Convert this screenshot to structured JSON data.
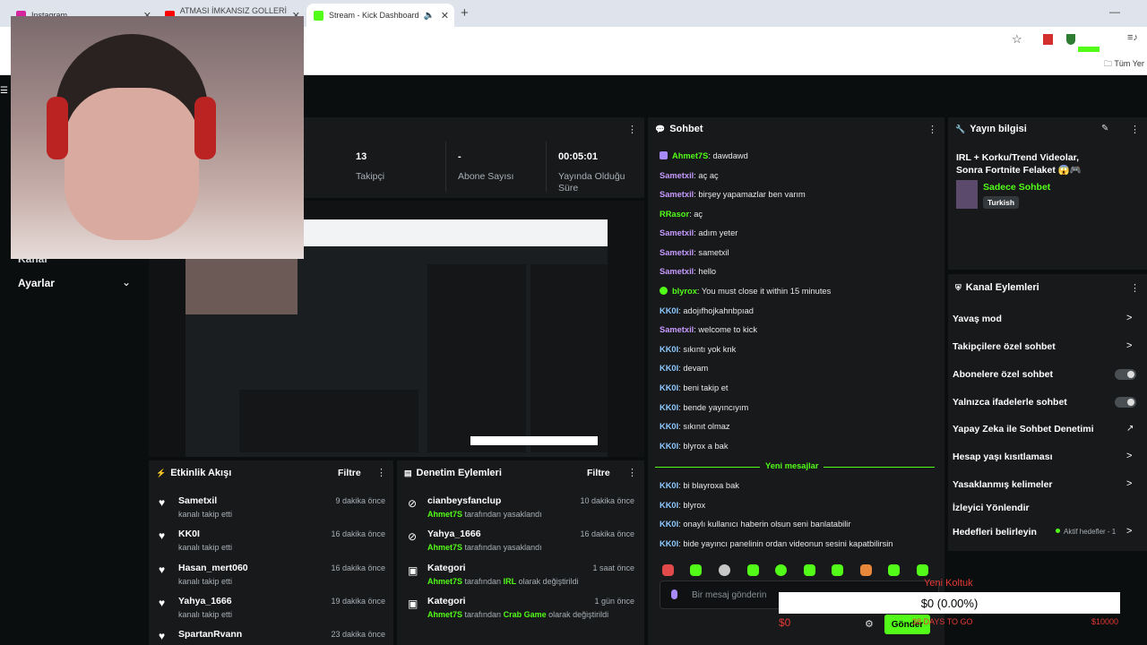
{
  "browser": {
    "tabs": [
      {
        "label": "Instagram"
      },
      {
        "label": "ATMASI İMKANSIZ GOLLERİ D..."
      },
      {
        "label": "Stream - Kick Dashboard"
      }
    ],
    "bookmarks_right": "Tüm Yer"
  },
  "sidebar": {
    "items": [
      {
        "label": "Kanal"
      },
      {
        "label": "Ayarlar"
      }
    ]
  },
  "stats": [
    {
      "value": "13",
      "label": "Takipçi"
    },
    {
      "value": "-",
      "label": "Abone Sayısı"
    },
    {
      "value": "00:05:01",
      "label": "Yayında Olduğu Süre"
    }
  ],
  "chat": {
    "title": "Sohbet",
    "messages": [
      {
        "user": "Ahmet7S",
        "text": ": dawdawd",
        "color": "#53fc18"
      },
      {
        "user": "Sametxil",
        "text": ": aç aç",
        "color": "#c79bff"
      },
      {
        "user": "Sametxil",
        "text": ": birşey yapamazlar ben varım",
        "color": "#c79bff"
      },
      {
        "user": "RRasor",
        "text": ": aç",
        "color": "#53fc18"
      },
      {
        "user": "Sametxil",
        "text": ": adım yeter",
        "color": "#c79bff"
      },
      {
        "user": "Sametxil",
        "text": ": sametxil",
        "color": "#c79bff"
      },
      {
        "user": "Sametxil",
        "text": ": hello",
        "color": "#c79bff"
      },
      {
        "user": "blyrox",
        "text": ": You must close it within 15 minutes",
        "color": "#53fc18"
      },
      {
        "user": "KK0I",
        "text": ": adojıfhojkahnbpıad",
        "color": "#8ec9ff"
      },
      {
        "user": "Sametxil",
        "text": ": welcome to kick",
        "color": "#c79bff"
      },
      {
        "user": "KK0I",
        "text": ": sıkıntı yok knk",
        "color": "#8ec9ff"
      },
      {
        "user": "KK0I",
        "text": ": devam",
        "color": "#8ec9ff"
      },
      {
        "user": "KK0I",
        "text": ": beni takip et",
        "color": "#8ec9ff"
      },
      {
        "user": "KK0I",
        "text": ": bende yayıncıyım",
        "color": "#8ec9ff"
      },
      {
        "user": "KK0I",
        "text": ": sıkınıt olmaz",
        "color": "#8ec9ff"
      },
      {
        "user": "KK0I",
        "text": ": blyrox a bak",
        "color": "#8ec9ff"
      }
    ],
    "new_messages_label": "Yeni mesajlar",
    "new_messages": [
      {
        "user": "KK0I",
        "text": ": bi blayroxa bak",
        "color": "#8ec9ff"
      },
      {
        "user": "KK0I",
        "text": ": blyrox",
        "color": "#8ec9ff"
      },
      {
        "user": "KK0I",
        "text": ": onaylı kullanıcı haberin olsun seni banlatabilir",
        "color": "#8ec9ff"
      },
      {
        "user": "KK0I",
        "text": ": bide yayıncı panelinin ordan videonun sesini kapatbilirsin",
        "color": "#8ec9ff"
      }
    ],
    "input_placeholder": "Bir mesaj gönderin",
    "send_label": "Gönder"
  },
  "stream_info": {
    "title": "Yayın bilgisi",
    "stream_title": "IRL + Korku/Trend Videolar, Sonra Fortnite Felaket 😱🎮",
    "category": "Sadece Sohbet",
    "language": "Turkish"
  },
  "channel_actions": {
    "title": "Kanal Eylemleri",
    "items": [
      {
        "label": "Yavaş mod"
      },
      {
        "label": "Takipçilere özel sohbet"
      },
      {
        "label": "Abonelere özel sohbet"
      },
      {
        "label": "Yalnızca ifadelerle sohbet"
      },
      {
        "label": "Yapay Zeka ile Sohbet Denetimi"
      },
      {
        "label": "Hesap yaşı kısıtlaması"
      },
      {
        "label": "Yasaklanmış kelimeler"
      },
      {
        "label": "İzleyici Yönlendir"
      },
      {
        "label": "Hedefleri belirleyin"
      }
    ],
    "goals_status": "Aktif hedefler - 1"
  },
  "activity": {
    "title": "Etkinlik Akışı",
    "filter": "Filtre",
    "items": [
      {
        "name": "Sametxil",
        "sub": "kanalı takip etti",
        "time": "9 dakika önce"
      },
      {
        "name": "KK0I",
        "sub": "kanalı takip etti",
        "time": "16 dakika önce"
      },
      {
        "name": "Hasan_mert060",
        "sub": "kanalı takip etti",
        "time": "16 dakika önce"
      },
      {
        "name": "Yahya_1666",
        "sub": "kanalı takip etti",
        "time": "19 dakika önce"
      },
      {
        "name": "SpartanRvann",
        "sub": "",
        "time": "23 dakika önce"
      }
    ]
  },
  "moderation": {
    "title": "Denetim Eylemleri",
    "filter": "Filtre",
    "items": [
      {
        "name": "cianbeysfanclup",
        "actor": "Ahmet7S",
        "sub": "tarafından yasaklandı",
        "time": "10 dakika önce"
      },
      {
        "name": "Yahya_1666",
        "actor": "Ahmet7S",
        "sub": "tarafından yasaklandı",
        "time": "16 dakika önce"
      },
      {
        "name": "Kategori",
        "actor": "Ahmet7S",
        "sub": "tarafından",
        "value": "IRL",
        "sub2": "olarak değiştirildi",
        "time": "1 saat önce"
      },
      {
        "name": "Kategori",
        "actor": "Ahmet7S",
        "sub": "tarafından",
        "value": "Crab Game",
        "sub2": "olarak değiştirildi",
        "time": "1 gün önce"
      }
    ]
  },
  "goal_overlay": {
    "title": "Yeni Koltuk",
    "progress_text": "$0 (0.00%)",
    "start": "$0",
    "days": "38 DAYS TO GO",
    "target": "$10000",
    "progress": 0
  },
  "colors": {
    "accent": "#53fc18",
    "panel": "#17191b",
    "background": "#0b0e0f"
  }
}
